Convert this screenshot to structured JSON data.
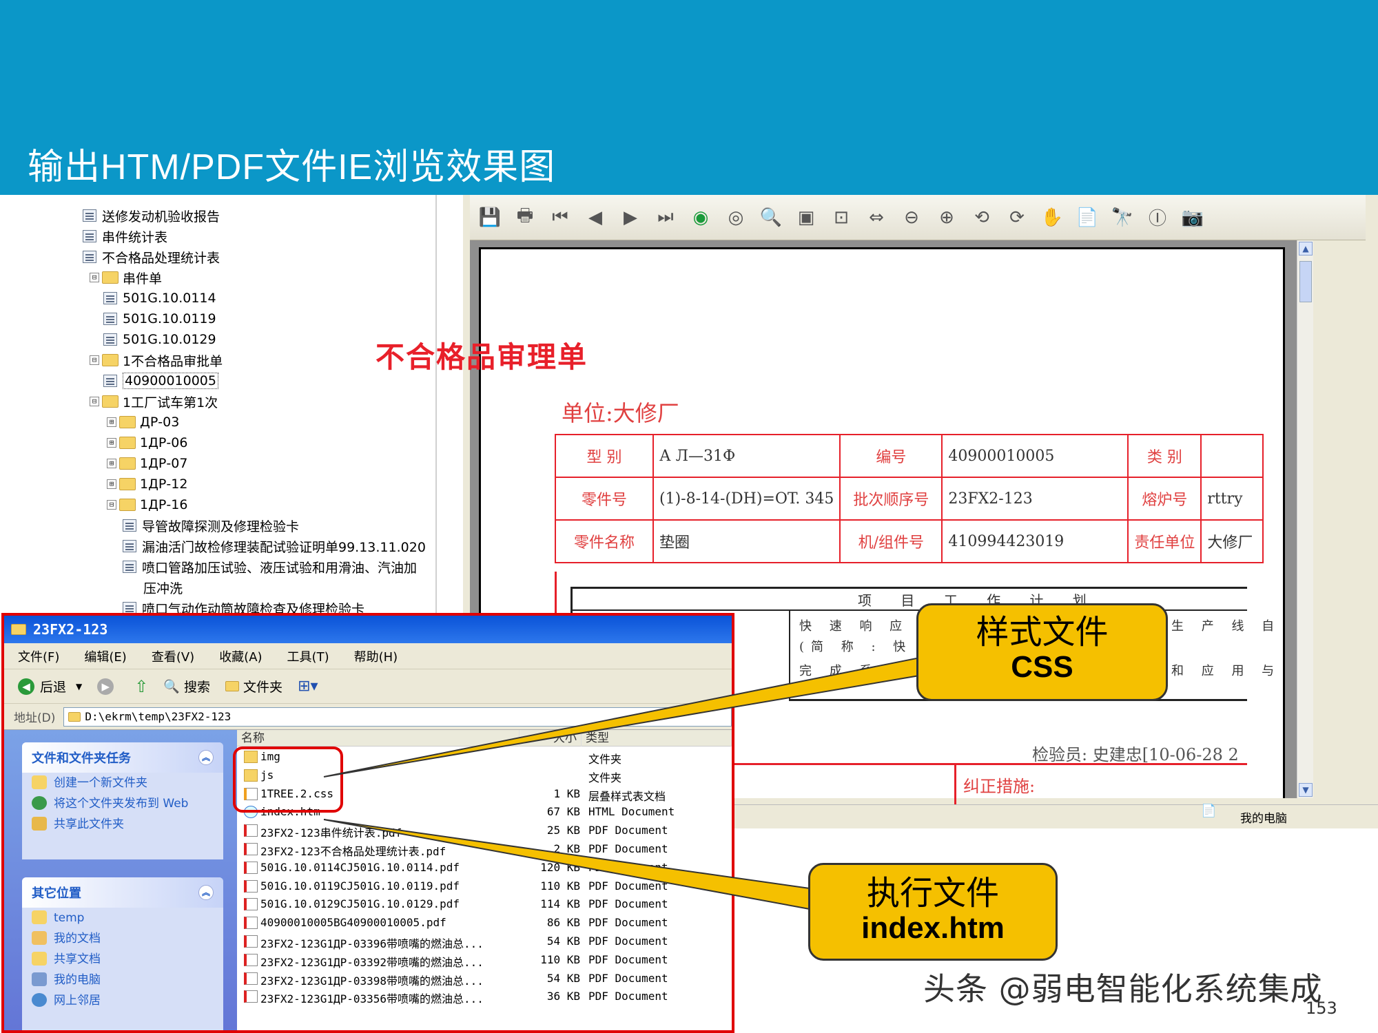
{
  "slide": {
    "title": "输出HTM/PDF文件IE浏览效果图",
    "page_number": "153",
    "watermark": "头条 @弱电智能化系统集成"
  },
  "tree": {
    "items": [
      {
        "label": "送修发动机验收报告",
        "type": "doc"
      },
      {
        "label": "串件统计表",
        "type": "doc"
      },
      {
        "label": "不合格品处理统计表",
        "type": "doc"
      },
      {
        "label": "串件单",
        "type": "folder",
        "expander": "⊟"
      },
      {
        "label": "501G.10.0114",
        "type": "doc"
      },
      {
        "label": "501G.10.0119",
        "type": "doc"
      },
      {
        "label": "501G.10.0129",
        "type": "doc"
      },
      {
        "label": "1不合格品审批单",
        "type": "folder",
        "expander": "⊟"
      },
      {
        "label": "40900010005",
        "type": "doc"
      },
      {
        "label": "1工厂试车第1次",
        "type": "folder",
        "expander": "⊟"
      },
      {
        "label": "ДР-03",
        "type": "folder",
        "expander": "⊞"
      },
      {
        "label": "1ДР-06",
        "type": "folder",
        "expander": "⊞"
      },
      {
        "label": "1ДР-07",
        "type": "folder",
        "expander": "⊞"
      },
      {
        "label": "1ДР-12",
        "type": "folder",
        "expander": "⊞"
      },
      {
        "label": "1ДР-16",
        "type": "folder",
        "expander": "⊟"
      },
      {
        "label": "导管故障探测及修理检验卡",
        "type": "doc"
      },
      {
        "label": "漏油活门故检修理装配试验证明单99.13.11.020",
        "type": "doc"
      },
      {
        "label": "喷口管路加压试验、液压试验和用滑油、汽油加",
        "type": "doc"
      },
      {
        "label": "压冲洗",
        "type": "text"
      },
      {
        "label": "喷口气动作动筒故障检查及修理检验卡",
        "type": "doc"
      }
    ]
  },
  "pdf": {
    "form_title": "不合格品审理单",
    "unit": "单位:大修厂",
    "rows": [
      [
        "型 别",
        "А Л—31Ф",
        "编号",
        "40900010005",
        "类 别",
        ""
      ],
      [
        "零件号",
        "(1)-8-14-(DH)=OT. 345",
        "批次顺序号",
        "23FX2-123",
        "熔炉号",
        "rttry"
      ],
      [
        "零件名称",
        "垫圈",
        "机/组件号",
        "410994423019",
        "责任单位",
        "大修厂"
      ]
    ],
    "plan_header": "项 目 工 作 计 划",
    "plan_line1": "快 速 响 应 制",
    "plan_line2": "(简 称 : 快",
    "plan_line3": "完 成 系 统",
    "plan_right1": "生 产 线 自",
    "plan_right2": "和 应 用 与",
    "inspector": "检验员:  史建忠[10-06-28 2",
    "corrective": "纠正措施:",
    "status_mycomputer": "我的电脑"
  },
  "explorer": {
    "title": "23FX2-123",
    "menu": [
      "文件(F)",
      "编辑(E)",
      "查看(V)",
      "收藏(A)",
      "工具(T)",
      "帮助(H)"
    ],
    "toolbar": {
      "back": "后退",
      "search": "搜索",
      "folders": "文件夹"
    },
    "address_label": "地址(D)",
    "address": "D:\\ekrm\\temp\\23FX2-123",
    "tasks_title": "文件和文件夹任务",
    "tasks": [
      "创建一个新文件夹",
      "将这个文件夹发布到 Web",
      "共享此文件夹"
    ],
    "places_title": "其它位置",
    "places": [
      "temp",
      "我的文档",
      "共享文档",
      "我的电脑",
      "网上邻居"
    ],
    "columns": {
      "name": "名称",
      "size": "大小",
      "type": "类型"
    },
    "files": [
      {
        "name": "img",
        "size": "",
        "type": "文件夹",
        "icon": "folder"
      },
      {
        "name": "js",
        "size": "",
        "type": "文件夹",
        "icon": "folder"
      },
      {
        "name": "1TREE.2.css",
        "size": "1 KB",
        "type": "层叠样式表文档",
        "icon": "css"
      },
      {
        "name": "index.htm",
        "size": "67 KB",
        "type": "HTML Document",
        "icon": "html"
      },
      {
        "name": "23FX2-123串件统计表.pdf",
        "size": "25 KB",
        "type": "PDF Document",
        "icon": "pdf"
      },
      {
        "name": "23FX2-123不合格品处理统计表.pdf",
        "size": "2 KB",
        "type": "PDF Document",
        "icon": "pdf"
      },
      {
        "name": "501G.10.0114CJ501G.10.0114.pdf",
        "size": "120 KB",
        "type": "PDF Document",
        "icon": "pdf"
      },
      {
        "name": "501G.10.0119CJ501G.10.0119.pdf",
        "size": "110 KB",
        "type": "PDF Document",
        "icon": "pdf"
      },
      {
        "name": "501G.10.0129CJ501G.10.0129.pdf",
        "size": "114 KB",
        "type": "PDF Document",
        "icon": "pdf"
      },
      {
        "name": "40900010005BG40900010005.pdf",
        "size": "86 KB",
        "type": "PDF Document",
        "icon": "pdf"
      },
      {
        "name": "23FX2-123G1ДР-03396带喷嘴的燃油总...",
        "size": "54 KB",
        "type": "PDF Document",
        "icon": "pdf"
      },
      {
        "name": "23FX2-123G1ДР-03392带喷嘴的燃油总...",
        "size": "110 KB",
        "type": "PDF Document",
        "icon": "pdf"
      },
      {
        "name": "23FX2-123G1ДР-03398带喷嘴的燃油总...",
        "size": "54 KB",
        "type": "PDF Document",
        "icon": "pdf"
      },
      {
        "name": "23FX2-123G1ДР-03356带喷嘴的燃油总...",
        "size": "36 KB",
        "type": "PDF Document",
        "icon": "pdf"
      }
    ]
  },
  "callouts": {
    "css": {
      "line1": "样式文件",
      "line2": "CSS"
    },
    "index": {
      "line1": "执行文件",
      "line2": "index.htm"
    }
  },
  "colors": {
    "banner": "#0b97c8",
    "callout": "#f5c000",
    "highlight": "#e00000",
    "form_red": "#e6202a"
  }
}
